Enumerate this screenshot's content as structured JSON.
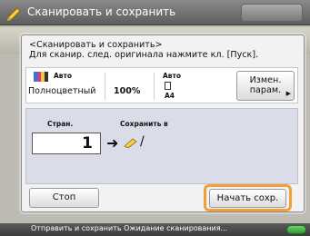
{
  "window": {
    "title": "Сканировать и сохранить"
  },
  "dialog": {
    "message_line1": "<Сканировать и сохранить>",
    "message_line2": "Для сканир. след. оригинала нажмите кл. [Пуск].",
    "info": {
      "color_label": "Авто",
      "color_value": "Полноцветный",
      "zoom_value": "100%",
      "paper_label": "Авто",
      "paper_value": "A4",
      "change_params_label_line1": "Измен.",
      "change_params_label_line2": "парам."
    },
    "pages_label": "Стран.",
    "pages_value": "1",
    "save_to_label": "Сохранить в",
    "save_to_value": "/",
    "stop_label": "Стоп",
    "start_save_label": "Начать сохр."
  },
  "status": {
    "text": "Отправить и сохранить Ожидание сканирования..."
  },
  "colors": {
    "highlight": "#f0a036",
    "titlebar": "#6f6f6f",
    "status_indicator": "#3fb13f"
  },
  "icons": {
    "app": "pen-icon",
    "color_mode": "color-mode-icon",
    "paper": "paper-icon",
    "destination": "pen-icon",
    "arrow": "arrow-right-icon"
  }
}
